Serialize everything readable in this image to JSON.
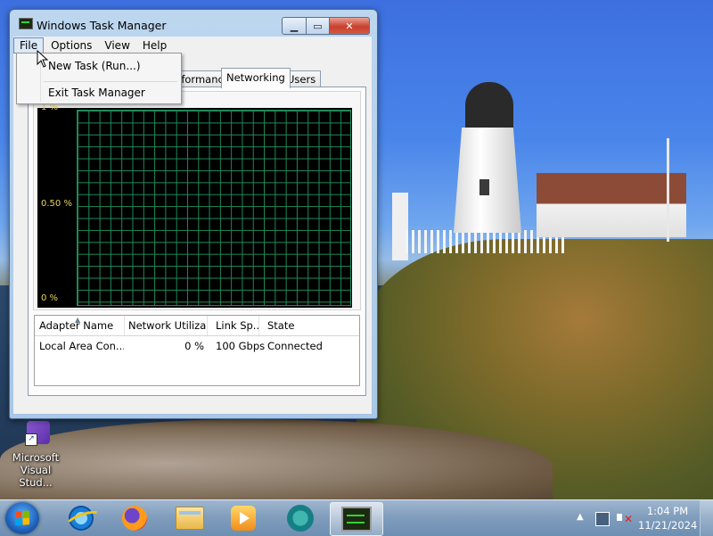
{
  "window": {
    "title": "Windows Task Manager",
    "controls": {
      "minimize": "▁",
      "maximize": "▭",
      "close": "✕"
    }
  },
  "menubar": {
    "items": [
      "File",
      "Options",
      "View",
      "Help"
    ],
    "active": "File"
  },
  "file_menu": {
    "items": [
      "New Task (Run...)",
      "Exit Task Manager"
    ]
  },
  "tabs": {
    "items": [
      "Performance",
      "Networking",
      "Users"
    ],
    "selected": "Networking"
  },
  "graph": {
    "y_labels": [
      "1 %",
      "0.50 %",
      "0 %"
    ],
    "colors": {
      "background": "#000000",
      "grid": "#1f8a5a",
      "labels": "#e7d35a"
    }
  },
  "adapter_table": {
    "columns": [
      "Adapter Name",
      "Network Utiliza...",
      "Link Sp...",
      "State"
    ],
    "rows": [
      [
        "Local Area Con...",
        "0 %",
        "100 Gbps",
        "Connected"
      ]
    ]
  },
  "desktop": {
    "icons": [
      {
        "label_line1": "Microsoft",
        "label_line2": "Visual Stud...",
        "icon": "visual-studio-icon"
      }
    ]
  },
  "taskbar": {
    "pinned": [
      "internet-explorer-icon",
      "firefox-icon",
      "windows-explorer-icon",
      "media-player-icon",
      "camtasia-icon",
      "task-manager-icon"
    ],
    "clock": {
      "time": "1:04 PM",
      "date": "11/21/2024"
    },
    "tray": [
      "show-hidden-icons-arrow",
      "network-icon",
      "volume-muted-icon"
    ]
  }
}
